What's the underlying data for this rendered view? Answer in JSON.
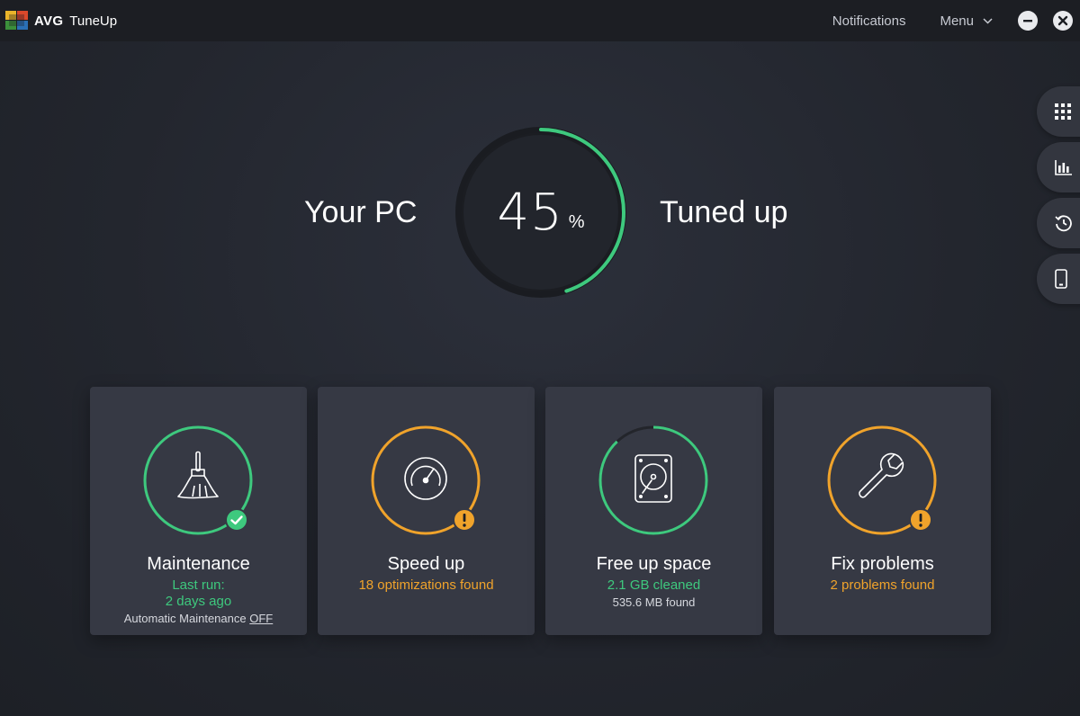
{
  "app": {
    "brand": "AVG",
    "product": "TuneUp"
  },
  "titlebar": {
    "notifications_label": "Notifications",
    "menu_label": "Menu"
  },
  "hero": {
    "left_text": "Your PC",
    "right_text": "Tuned up",
    "percent_value": "45",
    "percent_unit": "%",
    "progress_fraction": 0.45
  },
  "rail": {
    "items": [
      "grid-icon",
      "stats-chart-icon",
      "history-icon",
      "mobile-icon"
    ]
  },
  "cards": [
    {
      "title": "Maintenance",
      "line1": "Last run:",
      "line2": "2 days ago",
      "auto_prefix": "Automatic Maintenance",
      "auto_state": "OFF",
      "ring_color": "#3ec97e",
      "status": "ok"
    },
    {
      "title": "Speed up",
      "line1": "18 optimizations found",
      "ring_color": "#f0a32b",
      "status": "warning"
    },
    {
      "title": "Free up space",
      "line1": "2.1 GB cleaned",
      "line2": "535.6 MB found",
      "ring_color": "#3ec97e",
      "ring_fraction": 0.88,
      "status": "partial"
    },
    {
      "title": "Fix problems",
      "line1": "2 problems found",
      "ring_color": "#f0a32b",
      "status": "warning"
    }
  ],
  "colors": {
    "accent_green": "#3ec97e",
    "accent_orange": "#f0a32b",
    "card_bg": "#363944",
    "titlebar_bg": "#1c1e23"
  }
}
